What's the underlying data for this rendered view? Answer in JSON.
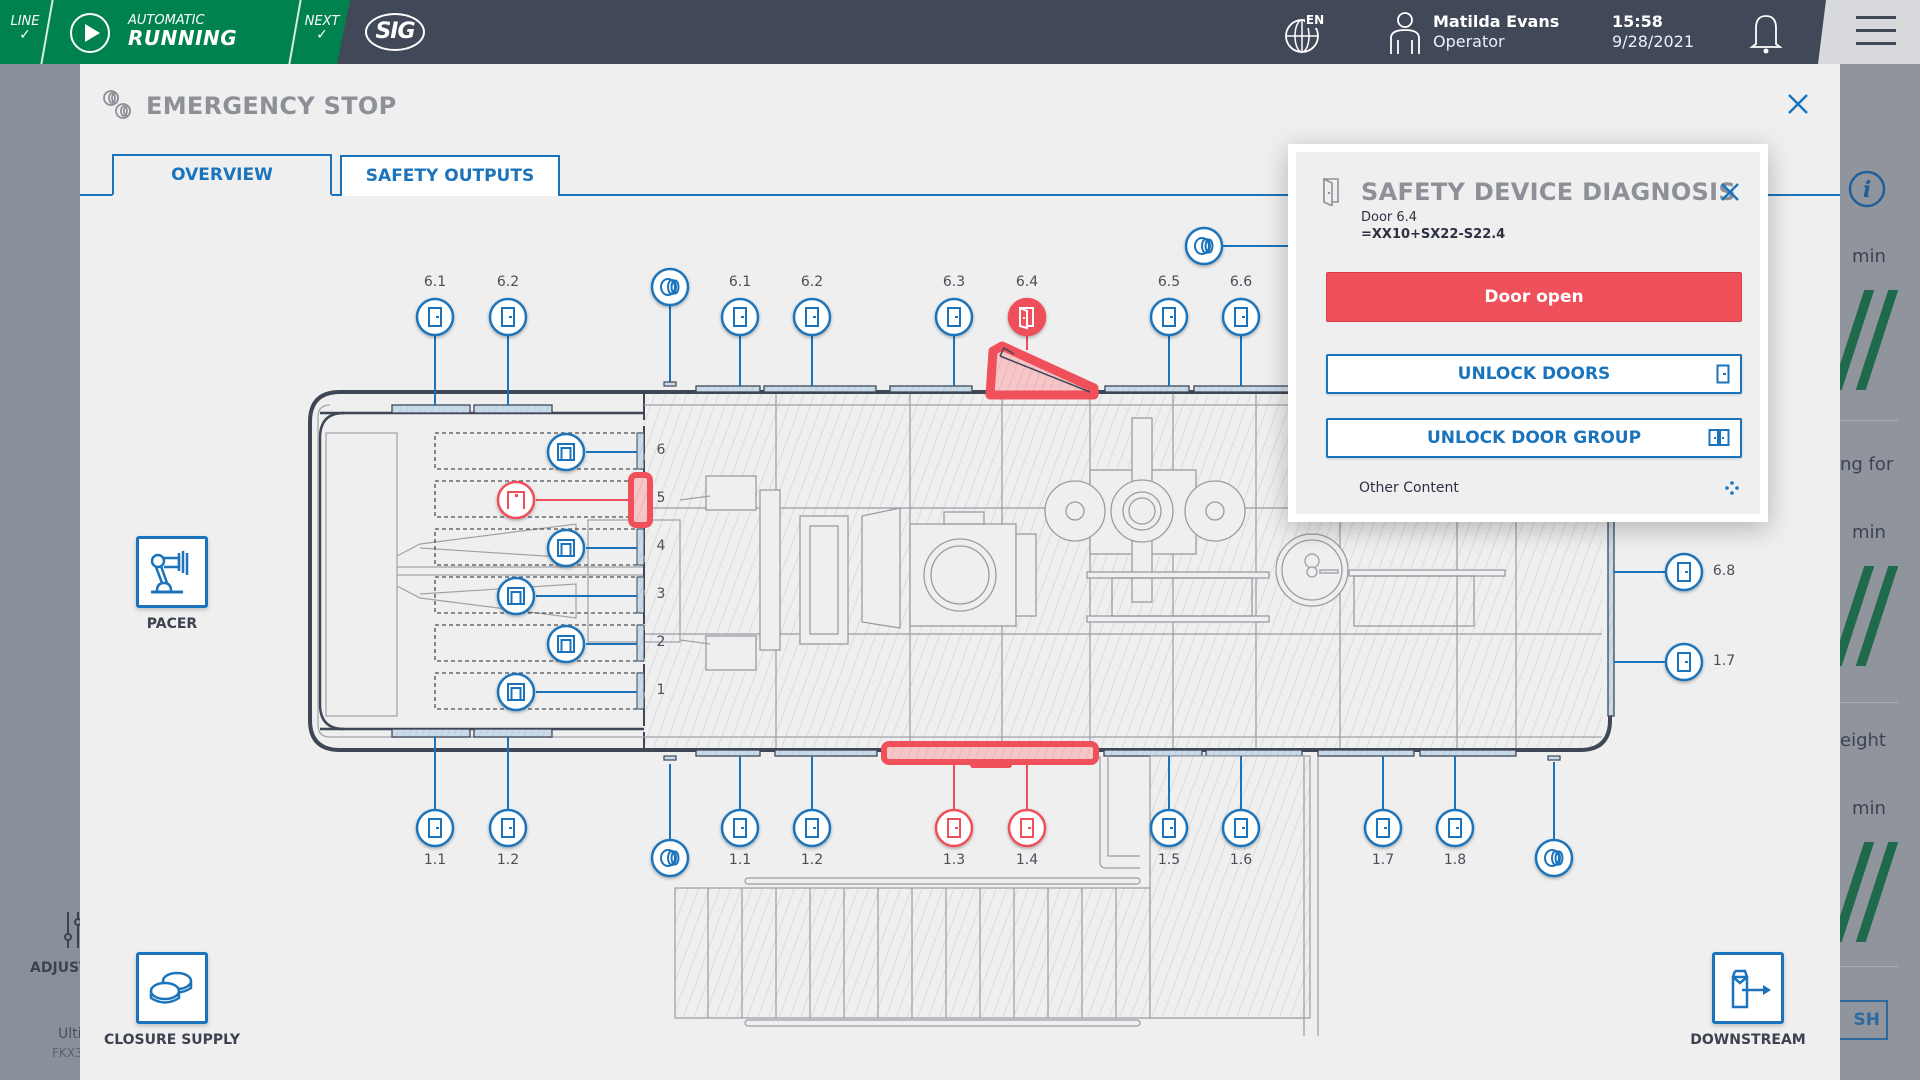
{
  "topbar": {
    "line_label": "LINE",
    "line_check": "✓",
    "mode_small": "AUTOMATIC",
    "mode_big": "RUNNING",
    "next_label": "NEXT",
    "next_check": "✓",
    "logo": "SIG",
    "language": "EN",
    "user_name": "Matilda Evans",
    "user_role": "Operator",
    "time": "15:58",
    "date": "9/28/2021",
    "status_color": "#00824f"
  },
  "background": {
    "right_texts": [
      "min",
      "ng for",
      "min",
      "eight",
      "min"
    ],
    "right_button": "SH",
    "left_label": "ADJUST",
    "left_sub1": "Ulti",
    "left_sub2": "FKX3"
  },
  "modal": {
    "title": "EMERGENCY STOP",
    "tabs": [
      {
        "label": "OVERVIEW",
        "active": true
      },
      {
        "label": "SAFETY OUTPUTS",
        "active": false
      }
    ],
    "side_buttons": {
      "pacer": "PACER",
      "closure_supply": "CLOSURE SUPPLY",
      "downstream": "DOWNSTREAM"
    }
  },
  "diagram": {
    "top_doors_left": [
      "6.1",
      "6.2"
    ],
    "top_doors": [
      "6.1",
      "6.2",
      "6.3",
      "6.4",
      "6.5",
      "6.6"
    ],
    "bottom_doors_left": [
      "1.1",
      "1.2"
    ],
    "bottom_doors": [
      "1.1",
      "1.2",
      "1.3",
      "1.4",
      "1.5",
      "1.6",
      "1.7",
      "1.8"
    ],
    "right_doors": [
      "6.8",
      "1.7"
    ],
    "slots": [
      "6",
      "5",
      "4",
      "3",
      "2",
      "1"
    ],
    "alarm_doors": [
      "6.4",
      "1.3",
      "1.4",
      "slot-5"
    ],
    "alarm_color": "#ef505a",
    "ok_color": "#1b74bb"
  },
  "popup": {
    "title": "SAFETY DEVICE DIAGNOSIS",
    "device": "Door 6.4",
    "device_code": "=XX10+SX22-S22.4",
    "status": "Door open",
    "unlock_doors": "UNLOCK DOORS",
    "unlock_group": "UNLOCK DOOR GROUP",
    "other_content": "Other Content"
  }
}
